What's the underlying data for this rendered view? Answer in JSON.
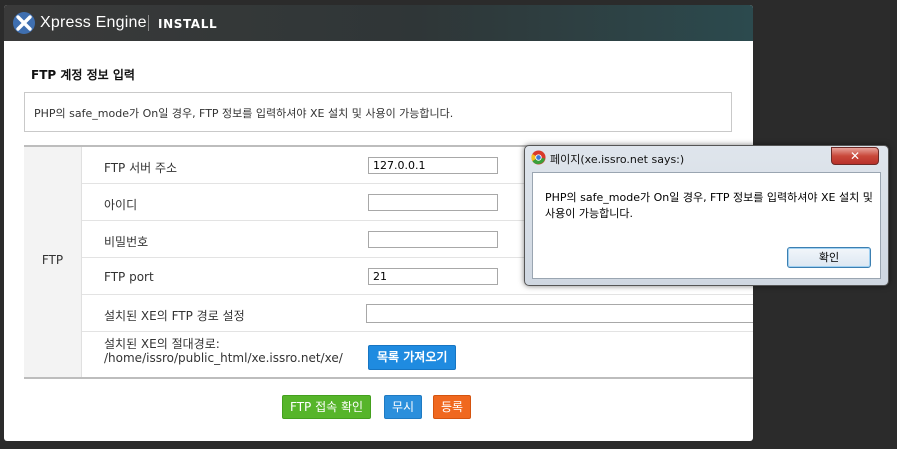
{
  "header": {
    "brand": "Xpress Engine",
    "section": "INSTALL"
  },
  "page": {
    "title": "FTP 계정 정보 입력",
    "info": "PHP의 safe_mode가 On일 경우, FTP 정보를 입력하셔야 XE 설치 및 사용이 가능합니다."
  },
  "form": {
    "group_label": "FTP",
    "rows": [
      {
        "label": "FTP 서버 주소",
        "value": "127.0.0.1"
      },
      {
        "label": "아이디",
        "value": ""
      },
      {
        "label": "비밀번호",
        "value": ""
      },
      {
        "label": "FTP port",
        "value": "21"
      },
      {
        "label": "설치된 XE의 FTP 경로 설정",
        "value": ""
      }
    ],
    "abs_path_label": "설치된 XE의 절대경로:",
    "abs_path_value": "/home/issro/public_html/xe.issro.net/xe/",
    "list_button": "목록 가져오기"
  },
  "buttons": {
    "ftp_check": "FTP 접속 확인",
    "skip": "무시",
    "register": "등록"
  },
  "alert": {
    "title": "페이지(xe.issro.net says:)",
    "close_label": "✕",
    "message": "PHP의 safe_mode가 On일 경우, FTP 정보를 입력하셔야 XE 설치 및 사용이 가능합니다.",
    "ok_label": "확인"
  },
  "colors": {
    "green_button": "#56b52a",
    "blue_button": "#2b8fdc",
    "orange_button": "#f0681f"
  }
}
